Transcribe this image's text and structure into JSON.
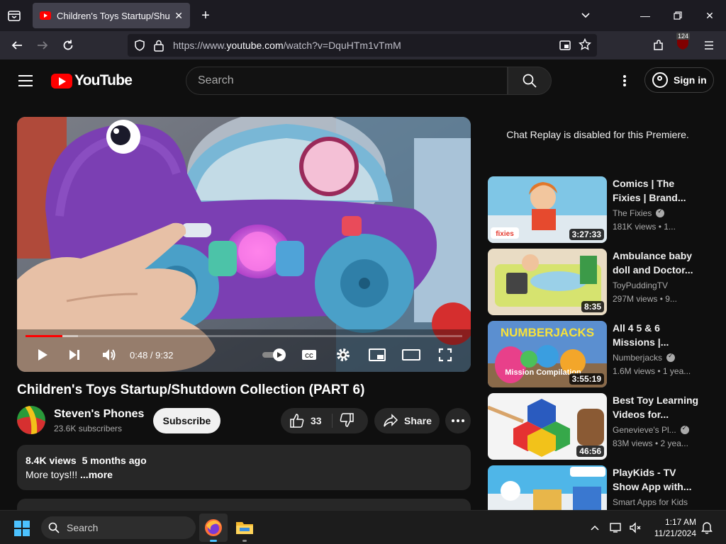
{
  "browser": {
    "tab_title": "Children's Toys Startup/Shutdo",
    "url_prefix": "https://www.",
    "url_host": "youtube.com",
    "url_path": "/watch?v=DquHTm1vTmM",
    "extension_badge": "124"
  },
  "header": {
    "logo_text": "YouTube",
    "search_placeholder": "Search",
    "signin_label": "Sign in"
  },
  "player": {
    "current_time": "0:48",
    "duration": "9:32",
    "time_display": "0:48 / 9:32",
    "played_fraction": 0.084,
    "buffered_fraction": 0.12
  },
  "video": {
    "title": "Children's Toys Startup/Shutdown Collection (PART 6)",
    "channel_name": "Steven's Phones",
    "subscribers": "23.6K subscribers",
    "subscribe_label": "Subscribe",
    "likes": "33",
    "share_label": "Share",
    "views": "8.4K views",
    "age": "5 months ago",
    "description": "More toys!!!",
    "more_label": "...more"
  },
  "sidebar": {
    "chat_replay_text": "Chat Replay is disabled for this Premiere.",
    "recommendations": [
      {
        "title": "Comics | The Fixies | Brand...",
        "channel": "The Fixies",
        "verified": true,
        "stats": "181K views • 1...",
        "duration": "3:27:33"
      },
      {
        "title": "Ambulance baby doll and Doctor...",
        "channel": "ToyPuddingTV",
        "verified": false,
        "stats": "297M views • 9...",
        "duration": "8:35"
      },
      {
        "title": "All 4 5 & 6 Missions |...",
        "channel": "Numberjacks",
        "verified": true,
        "stats": "1.6M views • 1 yea...",
        "duration": "3:55:19"
      },
      {
        "title": "Best Toy Learning Videos for...",
        "channel": "Genevieve's Pl...",
        "verified": true,
        "stats": "83M views • 2 yea...",
        "duration": "46:56"
      },
      {
        "title": "PlayKids - TV Show App with...",
        "channel": "Smart Apps for Kids",
        "verified": false,
        "stats": "",
        "duration": ""
      }
    ]
  },
  "taskbar": {
    "search_label": "Search",
    "time": "1:17 AM",
    "date": "11/21/2024"
  },
  "colors": {
    "yt_red": "#ff0000",
    "background": "#0f0f0f",
    "chip": "#272727"
  }
}
